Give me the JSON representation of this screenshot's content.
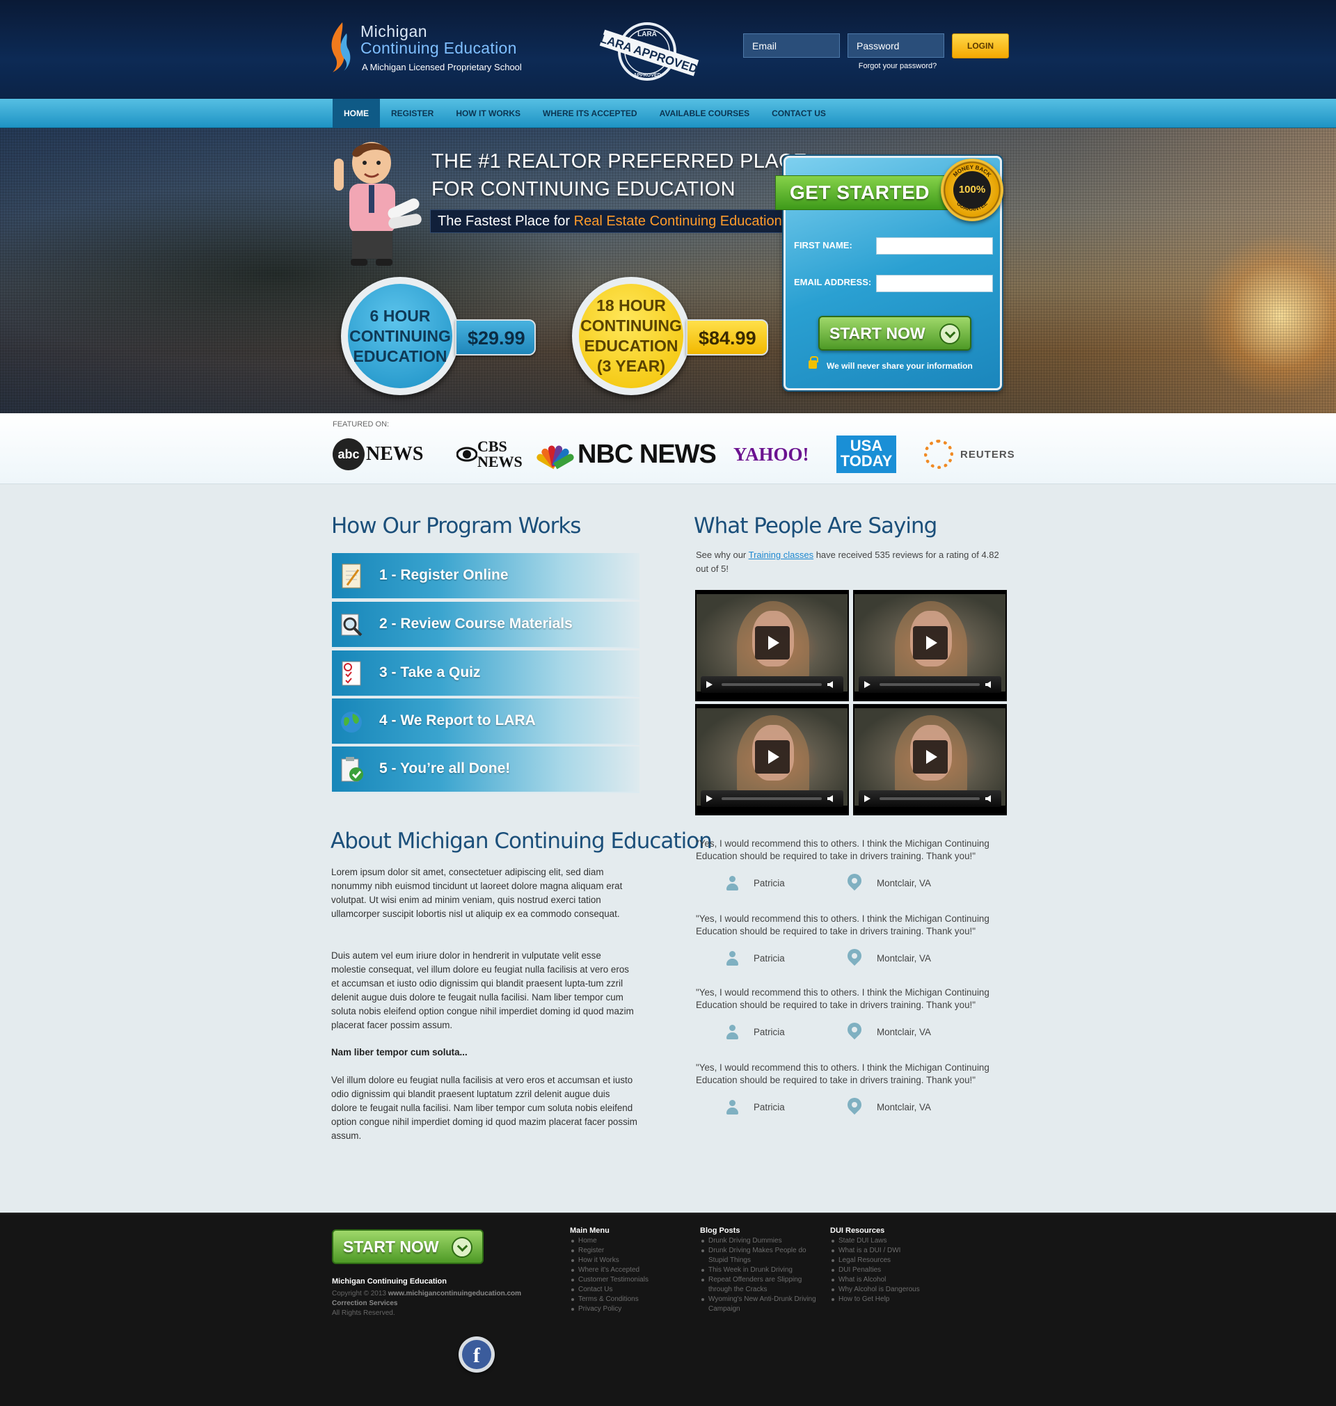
{
  "header": {
    "logo": {
      "line1": "Michigan",
      "line2": "Continuing Education",
      "tagline": "A Michigan Licensed Proprietary School"
    },
    "stamp": {
      "top": "LARA",
      "main": "LARA APPROVED",
      "bottom": "APPROVED"
    },
    "login": {
      "email_placeholder": "Email",
      "password_placeholder": "Password",
      "button": "LOGIN",
      "forgot": "Forgot your password?"
    }
  },
  "nav": {
    "items": [
      {
        "label": "HOME",
        "active": true
      },
      {
        "label": "REGISTER"
      },
      {
        "label": "HOW IT WORKS"
      },
      {
        "label": "WHERE ITS ACCEPTED"
      },
      {
        "label": "AVAILABLE COURSES"
      },
      {
        "label": "CONTACT US"
      }
    ]
  },
  "hero": {
    "headline1": "THE #1 REALTOR PREFERRED PLACE",
    "headline2": "FOR CONTINUING EDUCATION",
    "tag_prefix": "The Fastest Place for ",
    "tag_highlight": "Real Estate Continuing Education",
    "offers": [
      {
        "title": "6 HOUR CONTINUING EDUCATION",
        "price": "$29.99"
      },
      {
        "title": "18 HOUR CONTINUING EDUCATION (3 YEAR)",
        "price": "$84.99"
      }
    ],
    "signup": {
      "title": "GET STARTED",
      "badge_top": "MONEY BACK",
      "badge_center": "100%",
      "badge_bottom": "GUARANTEE",
      "first_name_label": "FIRST NAME:",
      "email_label": "EMAIL ADDRESS:",
      "button": "START NOW",
      "privacy": "We will never share your information"
    }
  },
  "featured": {
    "label": "FEATURED ON:",
    "logos": {
      "abc_mark": "abc",
      "abc_text": "NEWS",
      "cbs_top": "CBS",
      "cbs_bottom": "NEWS",
      "nbc": "NBC NEWS",
      "yahoo": "YAHOO!",
      "usa_top": "USA",
      "usa_bottom": "TODAY",
      "reuters": "REUTERS"
    }
  },
  "program": {
    "title": "How Our Program Works",
    "steps": [
      {
        "label": "1 - Register Online",
        "icon": "register-icon"
      },
      {
        "label": "2 - Review Course Materials",
        "icon": "magnifier-icon"
      },
      {
        "label": "3 - Take a Quiz",
        "icon": "quiz-icon"
      },
      {
        "label": "4 - We Report to LARA",
        "icon": "globe-icon"
      },
      {
        "label": "5 - You’re all Done!",
        "icon": "checklist-icon"
      }
    ]
  },
  "about": {
    "title": "About Michigan Continuing Education",
    "p1": "Lorem ipsum dolor sit amet, consectetuer adipiscing elit, sed diam nonummy nibh euismod tincidunt ut laoreet dolore magna aliquam erat volutpat. Ut wisi enim ad minim veniam, quis nostrud exerci tation ullamcorper suscipit lobortis nisl ut aliquip ex ea commodo consequat.",
    "p2": "Duis autem vel eum iriure dolor in hendrerit in vulputate velit esse molestie consequat, vel illum dolore eu feugiat nulla facilisis at vero eros et accumsan et iusto odio dignissim qui blandit praesent lupta-tum zzril delenit augue duis dolore te feugait nulla facilisi. Nam liber tempor cum soluta nobis eleifend option congue nihil imperdiet doming id quod mazim placerat facer possim assum.",
    "bold": "Nam liber tempor cum soluta...",
    "p3": "Vel illum dolore eu feugiat nulla facilisis at vero eros et accumsan et iusto odio dignissim qui blandit praesent luptatum zzril delenit augue duis dolore te feugait nulla facilisi. Nam liber tempor cum soluta nobis eleifend option congue nihil imperdiet doming id quod mazim placerat facer possim assum."
  },
  "testimonials": {
    "title": "What People Are Saying",
    "intro_before": "See why our ",
    "intro_link": "Training classes",
    "intro_after": " have received 535 reviews for a rating of 4.82 out of 5!",
    "quotes": [
      {
        "text": "\"Yes, I would recommend this to others. I think the Michigan Continuing Education  should be required to take in drivers training. Thank you!\"",
        "name": "Patricia",
        "location": "Montclair, VA"
      },
      {
        "text": "\"Yes, I would recommend this to others. I think the Michigan Continuing Education  should be required to take in drivers training. Thank you!\"",
        "name": "Patricia",
        "location": "Montclair, VA"
      },
      {
        "text": "\"Yes, I would recommend this to others. I think the Michigan Continuing Education  should be required to take in drivers training. Thank you!\"",
        "name": "Patricia",
        "location": "Montclair, VA"
      },
      {
        "text": "\"Yes, I would recommend this to others. I think the Michigan Continuing Education  should be required to take in drivers training. Thank you!\"",
        "name": "Patricia",
        "location": "Montclair, VA"
      }
    ]
  },
  "footer": {
    "button": "START NOW",
    "company": "Michigan Continuing Education",
    "copyright_prefix": "Copyright © 2013 ",
    "site": "www.michigancontinuingeducation.com",
    "correction": "Correction Services",
    "rights": "All Rights Reserved.",
    "facebook": "f",
    "columns": [
      {
        "title": "Main Menu",
        "items": [
          "Home",
          "Register",
          "How it Works",
          "Where it's Accepted",
          "Customer Testimonials",
          "Contact Us",
          "Terms & Conditions",
          "Privacy Policy"
        ]
      },
      {
        "title": "Blog Posts",
        "items": [
          "Drunk Driving Dummies",
          "Drunk Driving Makes People do Stupid Things",
          "This Week in Drunk Driving",
          "Repeat Offenders are Slipping through the Cracks",
          "Wyoming's New Anti-Drunk Driving Campaign"
        ]
      },
      {
        "title": "DUI Resources",
        "items": [
          "State DUI Laws",
          "What is a DUI / DWI",
          "Legal Resources",
          "DUI Penalties",
          "What is Alcohol",
          "Why Alcohol is Dangerous",
          "How to Get Help"
        ]
      }
    ]
  },
  "colors": {
    "navy": "#0b2347",
    "nav_blue": "#1e93c4",
    "accent_orange": "#ff9b2b",
    "cta_green": "#4e9a26",
    "heading_blue": "#1b4f7a"
  }
}
